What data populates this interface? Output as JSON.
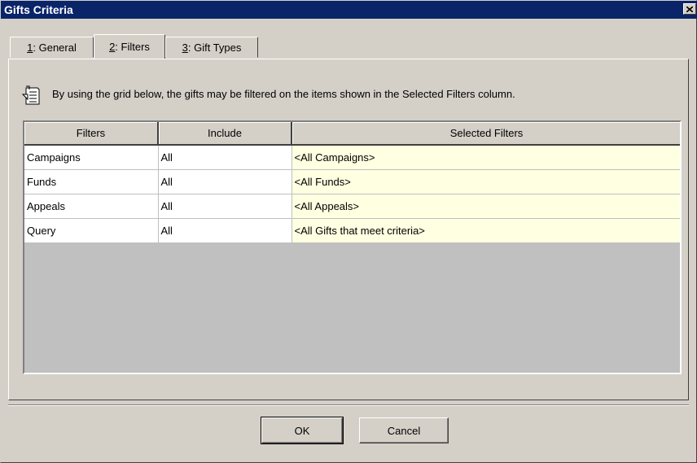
{
  "window": {
    "title": "Gifts Criteria"
  },
  "tabs": [
    {
      "hotkey": "1",
      "label": ": General",
      "active": false
    },
    {
      "hotkey": "2",
      "label": ": Filters",
      "active": true
    },
    {
      "hotkey": "3",
      "label": ": Gift Types",
      "active": false
    }
  ],
  "info": {
    "icon": "note-pad-icon",
    "text": "By using the grid below, the gifts may be filtered on the items shown in the Selected Filters column."
  },
  "grid": {
    "columns": [
      "Filters",
      "Include",
      "Selected Filters"
    ],
    "rows": [
      [
        "Campaigns",
        "All",
        "<All Campaigns>"
      ],
      [
        "Funds",
        "All",
        "<All Funds>"
      ],
      [
        "Appeals",
        "All",
        "<All Appeals>"
      ],
      [
        "Query",
        "All",
        "<All Gifts that meet criteria>"
      ]
    ],
    "selected_cell_color": "#ffffe1"
  },
  "buttons": {
    "ok": "OK",
    "cancel": "Cancel"
  },
  "colors": {
    "titlebar": "#0a246a",
    "face": "#d4d0c8"
  }
}
